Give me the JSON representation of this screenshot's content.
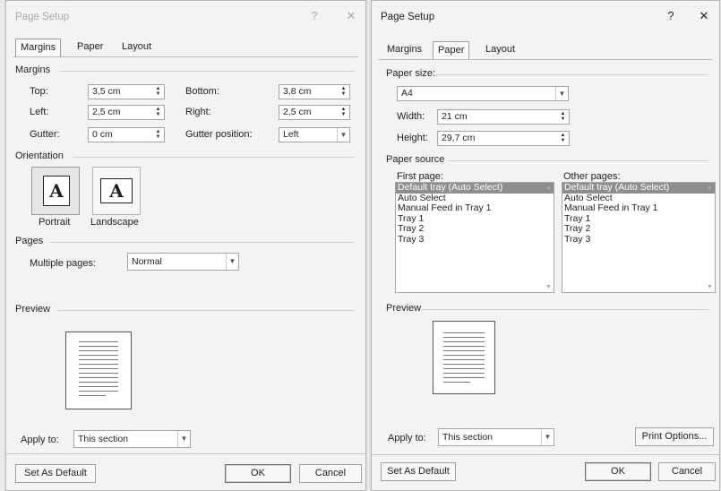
{
  "left_dialog": {
    "title": "Page Setup",
    "help": "?",
    "close": "✕",
    "tabs": [
      "Margins",
      "Paper",
      "Layout"
    ],
    "margins_group": "Margins",
    "top_label": "Top:",
    "top_value": "3,5 cm",
    "bottom_label": "Bottom:",
    "bottom_value": "3,8 cm",
    "left_label": "Left:",
    "left_value": "2,5 cm",
    "right_label": "Right:",
    "right_value": "2,5 cm",
    "gutter_label": "Gutter:",
    "gutter_value": "0 cm",
    "gutter_pos_label": "Gutter position:",
    "gutter_pos_value": "Left",
    "orientation_group": "Orientation",
    "portrait_label": "Portrait",
    "landscape_label": "Landscape",
    "orient_glyph": "A",
    "pages_group": "Pages",
    "multiple_pages_label": "Multiple pages:",
    "multiple_pages_value": "Normal",
    "preview_group": "Preview",
    "apply_to_label": "Apply to:",
    "apply_to_value": "This section",
    "set_default": "Set As Default",
    "ok": "OK",
    "cancel": "Cancel"
  },
  "right_dialog": {
    "title": "Page Setup",
    "help": "?",
    "close": "✕",
    "tabs": [
      "Margins",
      "Paper",
      "Layout"
    ],
    "paper_size_group": "Paper size:",
    "paper_size_value": "A4",
    "width_label": "Width:",
    "width_value": "21 cm",
    "height_label": "Height:",
    "height_value": "29,7 cm",
    "paper_source_group": "Paper source",
    "first_page_label": "First page:",
    "other_pages_label": "Other pages:",
    "trays": [
      "Default tray (Auto Select)",
      "Auto Select",
      "Manual Feed in Tray 1",
      "Tray 1",
      "Tray 2",
      "Tray 3"
    ],
    "preview_group": "Preview",
    "apply_to_label": "Apply to:",
    "apply_to_value": "This section",
    "print_options": "Print Options...",
    "set_default": "Set As Default",
    "ok": "OK",
    "cancel": "Cancel"
  },
  "icons": {
    "spinner": "spinner-icon",
    "dropdown": "chevron-down-icon",
    "scroll_up": "scroll-up-icon",
    "scroll_down": "scroll-down-icon"
  }
}
